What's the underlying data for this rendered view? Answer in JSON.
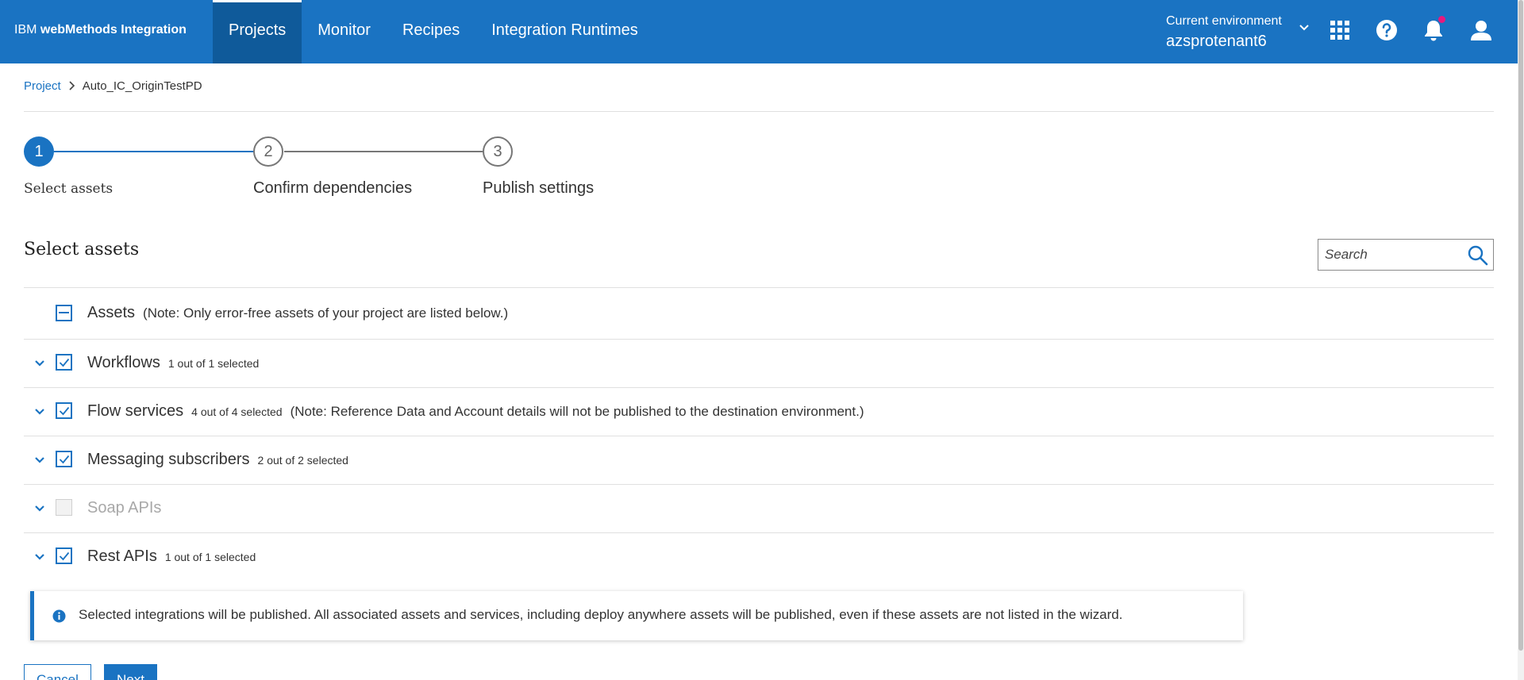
{
  "header": {
    "brand_prefix": "IBM",
    "brand_name": "webMethods Integration",
    "nav": [
      {
        "label": "Projects",
        "active": true
      },
      {
        "label": "Monitor",
        "active": false
      },
      {
        "label": "Recipes",
        "active": false
      },
      {
        "label": "Integration Runtimes",
        "active": false
      }
    ],
    "environment_label": "Current environment",
    "environment_value": "azsprotenant6",
    "icons": [
      "chevron-down-icon",
      "app-switcher-icon",
      "help-icon",
      "notification-icon",
      "user-icon"
    ]
  },
  "breadcrumb": {
    "project_link": "Project",
    "current": "Auto_IC_OriginTestPD"
  },
  "stepper": {
    "steps": [
      {
        "number": "1",
        "label": "Select assets",
        "state": "current"
      },
      {
        "number": "2",
        "label": "Confirm dependencies",
        "state": "pending"
      },
      {
        "number": "3",
        "label": "Publish settings",
        "state": "pending"
      }
    ]
  },
  "section": {
    "title": "Select assets",
    "search_placeholder": "Search"
  },
  "assets": {
    "header_label": "Assets",
    "header_note": "(Note: Only error-free assets of your project are listed below.)",
    "header_state": "indeterminate",
    "rows": [
      {
        "label": "Workflows",
        "count": "1 out of 1 selected",
        "note": "",
        "checked": true,
        "disabled": false
      },
      {
        "label": "Flow services",
        "count": "4 out of 4 selected",
        "note": "(Note: Reference Data and Account details will not be published to the destination environment.)",
        "checked": true,
        "disabled": false
      },
      {
        "label": "Messaging subscribers",
        "count": "2 out of 2 selected",
        "note": "",
        "checked": true,
        "disabled": false
      },
      {
        "label": "Soap APIs",
        "count": "",
        "note": "",
        "checked": false,
        "disabled": true
      },
      {
        "label": "Rest APIs",
        "count": "1 out of 1 selected",
        "note": "",
        "checked": true,
        "disabled": false
      }
    ]
  },
  "info_banner": {
    "text": "Selected integrations will be published. All associated assets and services, including deploy anywhere assets will be published, even if these assets are not listed in the wizard."
  },
  "actions": {
    "cancel_label": "Cancel",
    "next_label": "Next"
  },
  "colors": {
    "primary": "#1a73c2",
    "header_active": "#0f5a9a",
    "notification_dot": "#e8197d"
  }
}
